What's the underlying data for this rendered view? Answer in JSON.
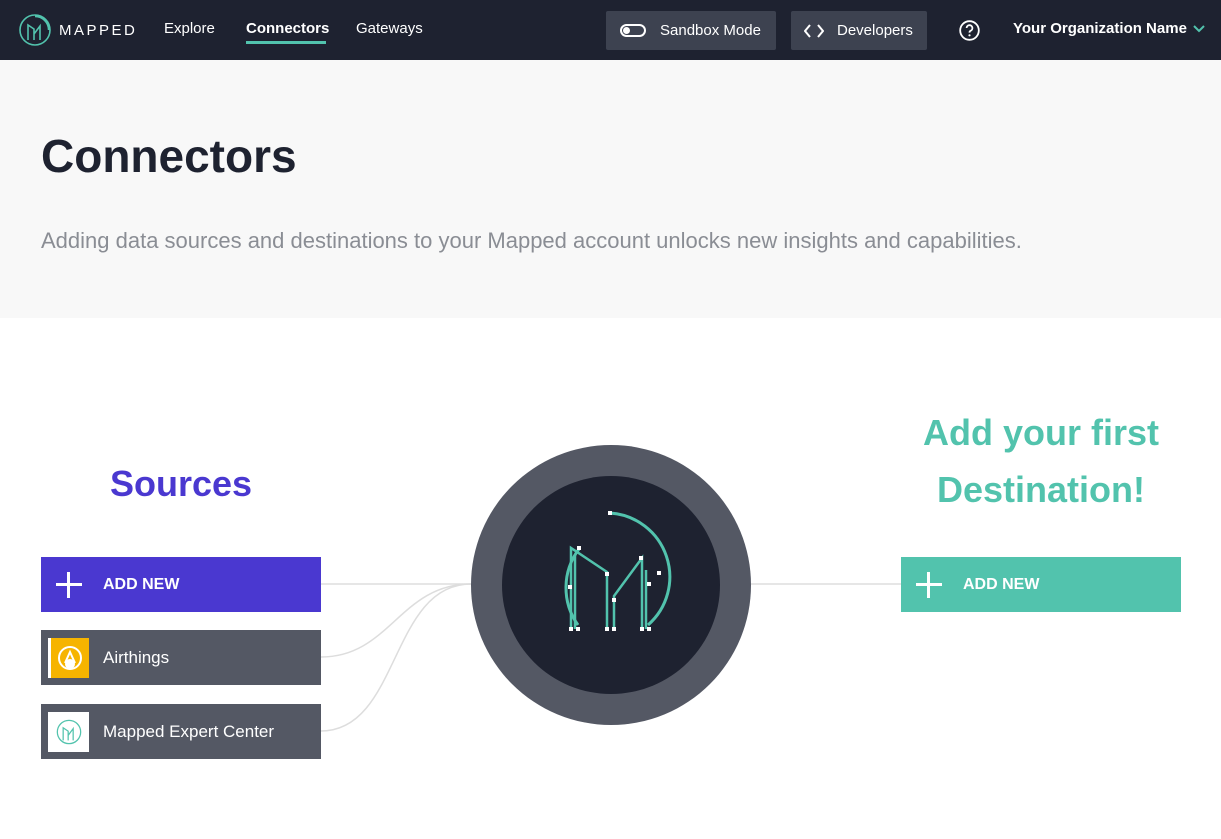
{
  "nav": {
    "brand": "MAPPED",
    "links": [
      {
        "label": "Explore",
        "active": false
      },
      {
        "label": "Connectors",
        "active": true
      },
      {
        "label": "Gateways",
        "active": false
      }
    ],
    "sandbox_label": "Sandbox Mode",
    "developers_label": "Developers",
    "org_name": "Your Organization Name"
  },
  "header": {
    "title": "Connectors",
    "subtitle": "Adding data sources and destinations to your Mapped account unlocks new insights and capabilities."
  },
  "sources": {
    "title": "Sources",
    "add_label": "ADD NEW",
    "items": [
      {
        "label": "Airthings",
        "icon": "airthings-logo-icon"
      },
      {
        "label": "Mapped Expert Center",
        "icon": "mapped-logo-icon"
      }
    ]
  },
  "destinations": {
    "title_line1": "Add your first",
    "title_line2": "Destination!",
    "add_label": "ADD NEW"
  },
  "colors": {
    "nav_bg": "#1e2230",
    "accent_teal": "#52c3ad",
    "accent_purple": "#4a38d0",
    "item_gray": "#545864",
    "airthings_yellow": "#f6b400"
  }
}
